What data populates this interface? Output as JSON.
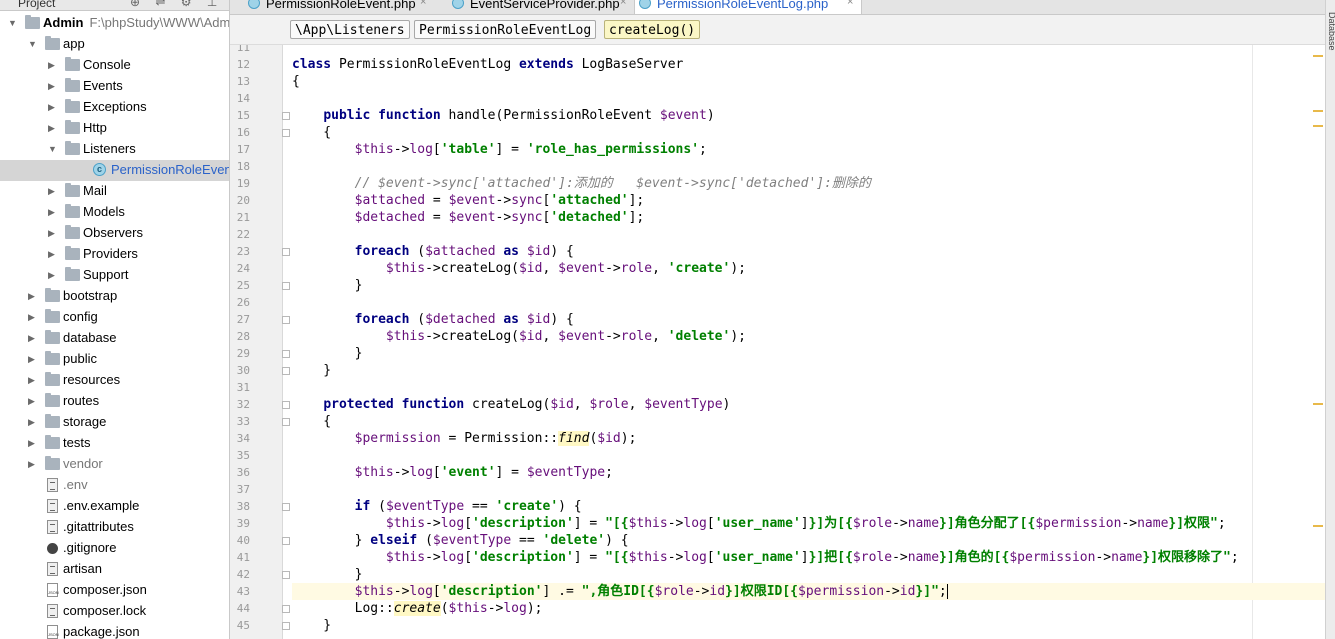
{
  "project": {
    "header": "Project",
    "tree": [
      {
        "label": "Admin",
        "path": "F:\\phpStudy\\WWW\\Admin",
        "type": "folder",
        "depth": 0,
        "open": true,
        "bold": true
      },
      {
        "label": "app",
        "type": "folder",
        "depth": 1,
        "open": true
      },
      {
        "label": "Console",
        "type": "folder",
        "depth": 2
      },
      {
        "label": "Events",
        "type": "folder",
        "depth": 2
      },
      {
        "label": "Exceptions",
        "type": "folder",
        "depth": 2
      },
      {
        "label": "Http",
        "type": "folder",
        "depth": 2
      },
      {
        "label": "Listeners",
        "type": "folder",
        "depth": 2,
        "open": true
      },
      {
        "label": "PermissionRoleEventLog",
        "type": "class",
        "depth": 3,
        "selected": true
      },
      {
        "label": "Mail",
        "type": "folder",
        "depth": 2
      },
      {
        "label": "Models",
        "type": "folder",
        "depth": 2
      },
      {
        "label": "Observers",
        "type": "folder",
        "depth": 2
      },
      {
        "label": "Providers",
        "type": "folder",
        "depth": 2
      },
      {
        "label": "Support",
        "type": "folder",
        "depth": 2
      },
      {
        "label": "bootstrap",
        "type": "folder",
        "depth": 1
      },
      {
        "label": "config",
        "type": "folder",
        "depth": 1
      },
      {
        "label": "database",
        "type": "folder",
        "depth": 1
      },
      {
        "label": "public",
        "type": "folder",
        "depth": 1
      },
      {
        "label": "resources",
        "type": "folder",
        "depth": 1
      },
      {
        "label": "routes",
        "type": "folder",
        "depth": 1
      },
      {
        "label": "storage",
        "type": "folder",
        "depth": 1
      },
      {
        "label": "tests",
        "type": "folder",
        "depth": 1
      },
      {
        "label": "vendor",
        "type": "folder",
        "depth": 1,
        "gray": true
      },
      {
        "label": ".env",
        "type": "file",
        "depth": 1,
        "gray": true
      },
      {
        "label": ".env.example",
        "type": "file",
        "depth": 1
      },
      {
        "label": ".gitattributes",
        "type": "file",
        "depth": 1
      },
      {
        "label": ".gitignore",
        "type": "git",
        "depth": 1
      },
      {
        "label": "artisan",
        "type": "file",
        "depth": 1
      },
      {
        "label": "composer.json",
        "type": "json",
        "depth": 1
      },
      {
        "label": "composer.lock",
        "type": "file",
        "depth": 1
      },
      {
        "label": "package.json",
        "type": "json",
        "depth": 1
      }
    ]
  },
  "tabs": [
    {
      "label": "PermissionRoleEvent.php"
    },
    {
      "label": "EventServiceProvider.php"
    },
    {
      "label": "PermissionRoleEventLog.php",
      "active": true
    }
  ],
  "breadcrumb": [
    "\\App\\Listeners",
    "PermissionRoleEventLog",
    "createLog()"
  ],
  "scrollbar_label": "Database",
  "editor": {
    "line_numbers": [
      "11",
      "12",
      "13",
      "14",
      "15",
      "16",
      "17",
      "18",
      "19",
      "20",
      "21",
      "22",
      "23",
      "24",
      "25",
      "26",
      "27",
      "28",
      "29",
      "30",
      "31",
      "32",
      "33",
      "34",
      "35",
      "36",
      "37",
      "38",
      "39",
      "40",
      "41",
      "42",
      "43",
      "44",
      "45"
    ],
    "lines": [
      [],
      [
        {
          "t": "class ",
          "c": "kw"
        },
        {
          "t": "PermissionRoleEventLog "
        },
        {
          "t": "extends ",
          "c": "kw"
        },
        {
          "t": "LogBaseServer"
        }
      ],
      [
        {
          "t": "{"
        }
      ],
      [],
      [
        {
          "t": "    "
        },
        {
          "t": "public function ",
          "c": "kw"
        },
        {
          "t": "handle(PermissionRoleEvent "
        },
        {
          "t": "$event",
          "c": "var"
        },
        {
          "t": ")"
        }
      ],
      [
        {
          "t": "    {"
        }
      ],
      [
        {
          "t": "        "
        },
        {
          "t": "$this",
          "c": "var"
        },
        {
          "t": "->"
        },
        {
          "t": "log",
          "c": "prop"
        },
        {
          "t": "["
        },
        {
          "t": "'table'",
          "c": "str"
        },
        {
          "t": "] = "
        },
        {
          "t": "'role_has_permissions'",
          "c": "str"
        },
        {
          "t": ";"
        }
      ],
      [],
      [
        {
          "t": "        "
        },
        {
          "t": "// $event->sync['attached']:添加的   $event->sync['detached']:删除的",
          "c": "cmt"
        }
      ],
      [
        {
          "t": "        "
        },
        {
          "t": "$attached",
          "c": "var"
        },
        {
          "t": " = "
        },
        {
          "t": "$event",
          "c": "var"
        },
        {
          "t": "->"
        },
        {
          "t": "sync",
          "c": "prop"
        },
        {
          "t": "["
        },
        {
          "t": "'attached'",
          "c": "str"
        },
        {
          "t": "];"
        }
      ],
      [
        {
          "t": "        "
        },
        {
          "t": "$detached",
          "c": "var"
        },
        {
          "t": " = "
        },
        {
          "t": "$event",
          "c": "var"
        },
        {
          "t": "->"
        },
        {
          "t": "sync",
          "c": "prop"
        },
        {
          "t": "["
        },
        {
          "t": "'detached'",
          "c": "str"
        },
        {
          "t": "];"
        }
      ],
      [],
      [
        {
          "t": "        "
        },
        {
          "t": "foreach ",
          "c": "kw"
        },
        {
          "t": "("
        },
        {
          "t": "$attached",
          "c": "var"
        },
        {
          "t": " "
        },
        {
          "t": "as ",
          "c": "kw"
        },
        {
          "t": "$id",
          "c": "var"
        },
        {
          "t": ") {"
        }
      ],
      [
        {
          "t": "            "
        },
        {
          "t": "$this",
          "c": "var"
        },
        {
          "t": "->createLog("
        },
        {
          "t": "$id",
          "c": "var"
        },
        {
          "t": ", "
        },
        {
          "t": "$event",
          "c": "var"
        },
        {
          "t": "->"
        },
        {
          "t": "role",
          "c": "prop"
        },
        {
          "t": ", "
        },
        {
          "t": "'create'",
          "c": "str"
        },
        {
          "t": ");"
        }
      ],
      [
        {
          "t": "        }"
        }
      ],
      [],
      [
        {
          "t": "        "
        },
        {
          "t": "foreach ",
          "c": "kw"
        },
        {
          "t": "("
        },
        {
          "t": "$detached",
          "c": "var"
        },
        {
          "t": " "
        },
        {
          "t": "as ",
          "c": "kw"
        },
        {
          "t": "$id",
          "c": "var"
        },
        {
          "t": ") {"
        }
      ],
      [
        {
          "t": "            "
        },
        {
          "t": "$this",
          "c": "var"
        },
        {
          "t": "->createLog("
        },
        {
          "t": "$id",
          "c": "var"
        },
        {
          "t": ", "
        },
        {
          "t": "$event",
          "c": "var"
        },
        {
          "t": "->"
        },
        {
          "t": "role",
          "c": "prop"
        },
        {
          "t": ", "
        },
        {
          "t": "'delete'",
          "c": "str"
        },
        {
          "t": ");"
        }
      ],
      [
        {
          "t": "        }"
        }
      ],
      [
        {
          "t": "    }"
        }
      ],
      [],
      [
        {
          "t": "    "
        },
        {
          "t": "protected function ",
          "c": "kw"
        },
        {
          "t": "createLog("
        },
        {
          "t": "$id",
          "c": "var"
        },
        {
          "t": ", "
        },
        {
          "t": "$role",
          "c": "var"
        },
        {
          "t": ", "
        },
        {
          "t": "$eventType",
          "c": "var"
        },
        {
          "t": ")"
        }
      ],
      [
        {
          "t": "    {"
        }
      ],
      [
        {
          "t": "        "
        },
        {
          "t": "$permission",
          "c": "var"
        },
        {
          "t": " = Permission::"
        },
        {
          "t": "find",
          "c": "fnit"
        },
        {
          "t": "("
        },
        {
          "t": "$id",
          "c": "var"
        },
        {
          "t": ");"
        }
      ],
      [],
      [
        {
          "t": "        "
        },
        {
          "t": "$this",
          "c": "var"
        },
        {
          "t": "->"
        },
        {
          "t": "log",
          "c": "prop"
        },
        {
          "t": "["
        },
        {
          "t": "'event'",
          "c": "str"
        },
        {
          "t": "] = "
        },
        {
          "t": "$eventType",
          "c": "var"
        },
        {
          "t": ";"
        }
      ],
      [],
      [
        {
          "t": "        "
        },
        {
          "t": "if ",
          "c": "kw"
        },
        {
          "t": "("
        },
        {
          "t": "$eventType",
          "c": "var"
        },
        {
          "t": " == "
        },
        {
          "t": "'create'",
          "c": "str"
        },
        {
          "t": ") {"
        }
      ],
      [
        {
          "t": "            "
        },
        {
          "t": "$this",
          "c": "var"
        },
        {
          "t": "->"
        },
        {
          "t": "log",
          "c": "prop"
        },
        {
          "t": "["
        },
        {
          "t": "'description'",
          "c": "str"
        },
        {
          "t": "] = "
        },
        {
          "t": "\"[{",
          "c": "str"
        },
        {
          "t": "$this",
          "c": "var"
        },
        {
          "t": "->"
        },
        {
          "t": "log",
          "c": "prop"
        },
        {
          "t": "["
        },
        {
          "t": "'user_name'",
          "c": "str"
        },
        {
          "t": "]"
        },
        {
          "t": "}]为[{",
          "c": "str"
        },
        {
          "t": "$role",
          "c": "var"
        },
        {
          "t": "->"
        },
        {
          "t": "name",
          "c": "prop"
        },
        {
          "t": "}]角色分配了[{",
          "c": "str"
        },
        {
          "t": "$permission",
          "c": "var"
        },
        {
          "t": "->"
        },
        {
          "t": "name",
          "c": "prop"
        },
        {
          "t": "}]权限\"",
          "c": "str"
        },
        {
          "t": ";"
        }
      ],
      [
        {
          "t": "        } "
        },
        {
          "t": "elseif ",
          "c": "kw"
        },
        {
          "t": "("
        },
        {
          "t": "$eventType",
          "c": "var"
        },
        {
          "t": " == "
        },
        {
          "t": "'delete'",
          "c": "str"
        },
        {
          "t": ") {"
        }
      ],
      [
        {
          "t": "            "
        },
        {
          "t": "$this",
          "c": "var"
        },
        {
          "t": "->"
        },
        {
          "t": "log",
          "c": "prop"
        },
        {
          "t": "["
        },
        {
          "t": "'description'",
          "c": "str"
        },
        {
          "t": "] = "
        },
        {
          "t": "\"[{",
          "c": "str"
        },
        {
          "t": "$this",
          "c": "var"
        },
        {
          "t": "->"
        },
        {
          "t": "log",
          "c": "prop"
        },
        {
          "t": "["
        },
        {
          "t": "'user_name'",
          "c": "str"
        },
        {
          "t": "]"
        },
        {
          "t": "}]把[{",
          "c": "str"
        },
        {
          "t": "$role",
          "c": "var"
        },
        {
          "t": "->"
        },
        {
          "t": "name",
          "c": "prop"
        },
        {
          "t": "}]角色的[{",
          "c": "str"
        },
        {
          "t": "$permission",
          "c": "var"
        },
        {
          "t": "->"
        },
        {
          "t": "name",
          "c": "prop"
        },
        {
          "t": "}]权限移除了\"",
          "c": "str"
        },
        {
          "t": ";"
        }
      ],
      [
        {
          "t": "        }"
        }
      ],
      [
        {
          "t": "        "
        },
        {
          "t": "$this",
          "c": "var"
        },
        {
          "t": "->"
        },
        {
          "t": "log",
          "c": "prop"
        },
        {
          "t": "["
        },
        {
          "t": "'description'",
          "c": "str"
        },
        {
          "t": "] .= "
        },
        {
          "t": "\",角色ID[{",
          "c": "str"
        },
        {
          "t": "$role",
          "c": "var"
        },
        {
          "t": "->"
        },
        {
          "t": "id",
          "c": "prop"
        },
        {
          "t": "}]权限ID[{",
          "c": "str"
        },
        {
          "t": "$permission",
          "c": "var"
        },
        {
          "t": "->"
        },
        {
          "t": "id",
          "c": "prop"
        },
        {
          "t": "}]\"",
          "c": "str"
        },
        {
          "t": ";"
        }
      ],
      [
        {
          "t": "        Log::"
        },
        {
          "t": "create",
          "c": "fnit"
        },
        {
          "t": "("
        },
        {
          "t": "$this",
          "c": "var"
        },
        {
          "t": "->"
        },
        {
          "t": "log",
          "c": "prop"
        },
        {
          "t": ");"
        }
      ],
      [
        {
          "t": "    }"
        }
      ]
    ]
  }
}
